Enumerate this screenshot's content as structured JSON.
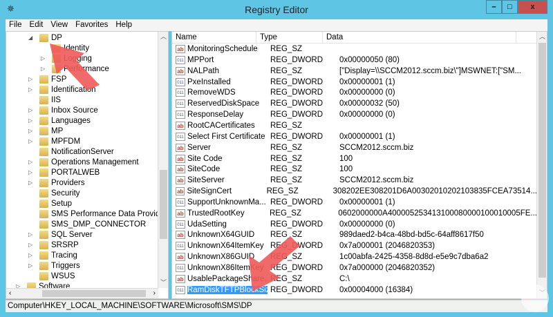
{
  "window": {
    "title": "Registry Editor",
    "minimize": "–",
    "maximize": "□",
    "close": "x"
  },
  "menu": [
    "File",
    "Edit",
    "View",
    "Favorites",
    "Help"
  ],
  "tree": [
    {
      "label": "DP",
      "level": 1,
      "exp": "◢"
    },
    {
      "label": "Identity",
      "level": 2,
      "exp": ""
    },
    {
      "label": "Logging",
      "level": 2,
      "exp": "▷"
    },
    {
      "label": "Performance",
      "level": 2,
      "exp": "▷"
    },
    {
      "label": "FSP",
      "level": 1,
      "exp": "▷"
    },
    {
      "label": "Identification",
      "level": 1,
      "exp": "▷"
    },
    {
      "label": "IIS",
      "level": 1,
      "exp": ""
    },
    {
      "label": "Inbox Source",
      "level": 1,
      "exp": "▷"
    },
    {
      "label": "Languages",
      "level": 1,
      "exp": "▷"
    },
    {
      "label": "MP",
      "level": 1,
      "exp": "▷"
    },
    {
      "label": "MPFDM",
      "level": 1,
      "exp": "▷"
    },
    {
      "label": "NotificationServer",
      "level": 1,
      "exp": ""
    },
    {
      "label": "Operations Management",
      "level": 1,
      "exp": "▷"
    },
    {
      "label": "PORTALWEB",
      "level": 1,
      "exp": "▷"
    },
    {
      "label": "Providers",
      "level": 1,
      "exp": "▷"
    },
    {
      "label": "Security",
      "level": 1,
      "exp": ""
    },
    {
      "label": "Setup",
      "level": 1,
      "exp": ""
    },
    {
      "label": "SMS Performance Data Provider",
      "level": 1,
      "exp": ""
    },
    {
      "label": "SMS_DMP_CONNECTOR",
      "level": 1,
      "exp": ""
    },
    {
      "label": "SQL Server",
      "level": 1,
      "exp": "▷"
    },
    {
      "label": "SRSRP",
      "level": 1,
      "exp": "▷"
    },
    {
      "label": "Tracing",
      "level": 1,
      "exp": "▷"
    },
    {
      "label": "Triggers",
      "level": 1,
      "exp": "▷"
    },
    {
      "label": "WSUS",
      "level": 1,
      "exp": ""
    },
    {
      "label": "Software",
      "level": 0,
      "exp": "▷"
    }
  ],
  "columns": {
    "name": "Name",
    "type": "Type",
    "data": "Data"
  },
  "values": [
    {
      "name": "MonitoringSchedule",
      "type": "REG_SZ",
      "data": ""
    },
    {
      "name": "MPPort",
      "type": "REG_DWORD",
      "data": "0x00000050 (80)"
    },
    {
      "name": "NALPath",
      "type": "REG_SZ",
      "data": "[\"Display=\\\\SCCM2012.sccm.biz\\\"]MSWNET:[\"SM..."
    },
    {
      "name": "PxeInstalled",
      "type": "REG_DWORD",
      "data": "0x00000001 (1)"
    },
    {
      "name": "RemoveWDS",
      "type": "REG_DWORD",
      "data": "0x00000000 (0)"
    },
    {
      "name": "ReservedDiskSpace",
      "type": "REG_DWORD",
      "data": "0x00000032 (50)"
    },
    {
      "name": "ResponseDelay",
      "type": "REG_DWORD",
      "data": "0x00000000 (0)"
    },
    {
      "name": "RootCACertificates",
      "type": "REG_SZ",
      "data": ""
    },
    {
      "name": "Select First Certificate",
      "type": "REG_DWORD",
      "data": "0x00000001 (1)"
    },
    {
      "name": "Server",
      "type": "REG_SZ",
      "data": "SCCM2012.sccm.biz"
    },
    {
      "name": "Site Code",
      "type": "REG_SZ",
      "data": "100"
    },
    {
      "name": "SiteCode",
      "type": "REG_SZ",
      "data": "100"
    },
    {
      "name": "SiteServer",
      "type": "REG_SZ",
      "data": "SCCM2012.sccm.biz"
    },
    {
      "name": "SiteSignCert",
      "type": "REG_SZ",
      "data": "308202EE308201D6A00302010202103835FCEA73514..."
    },
    {
      "name": "SupportUnknownMa...",
      "type": "REG_DWORD",
      "data": "0x00000001 (1)"
    },
    {
      "name": "TrustedRootKey",
      "type": "REG_SZ",
      "data": "0602000000A400005253413100080000100010005FE..."
    },
    {
      "name": "UdaSetting",
      "type": "REG_DWORD",
      "data": "0x00000000 (0)"
    },
    {
      "name": "UnknownX64GUID",
      "type": "REG_SZ",
      "data": "989daed2-b4ca-48bd-bd5c-64aff8617f50"
    },
    {
      "name": "UnknownX64ItemKey",
      "type": "REG_DWORD",
      "data": "0x7a000001 (2046820353)"
    },
    {
      "name": "UnknownX86GUID",
      "type": "REG_SZ",
      "data": "1c00abfa-2425-4358-8d8d-e5e9c7dba6a2"
    },
    {
      "name": "UnknownX86ItemKey",
      "type": "REG_DWORD",
      "data": "0x7a000000 (2046820352)"
    },
    {
      "name": "UsablePackageShare...",
      "type": "REG_SZ",
      "data": "C:\\"
    },
    {
      "name": "RamDiskTFTPBlockSize",
      "type": "REG_DWORD",
      "data": "0x00004000 (16384)",
      "selected": true
    }
  ],
  "status": "Computer\\HKEY_LOCAL_MACHINE\\SOFTWARE\\Microsoft\\SMS\\DP",
  "colors": {
    "titlebar": "#5ec6e4",
    "close": "#c75050",
    "selection": "#3399ff",
    "annotation": "#f05a5a"
  }
}
